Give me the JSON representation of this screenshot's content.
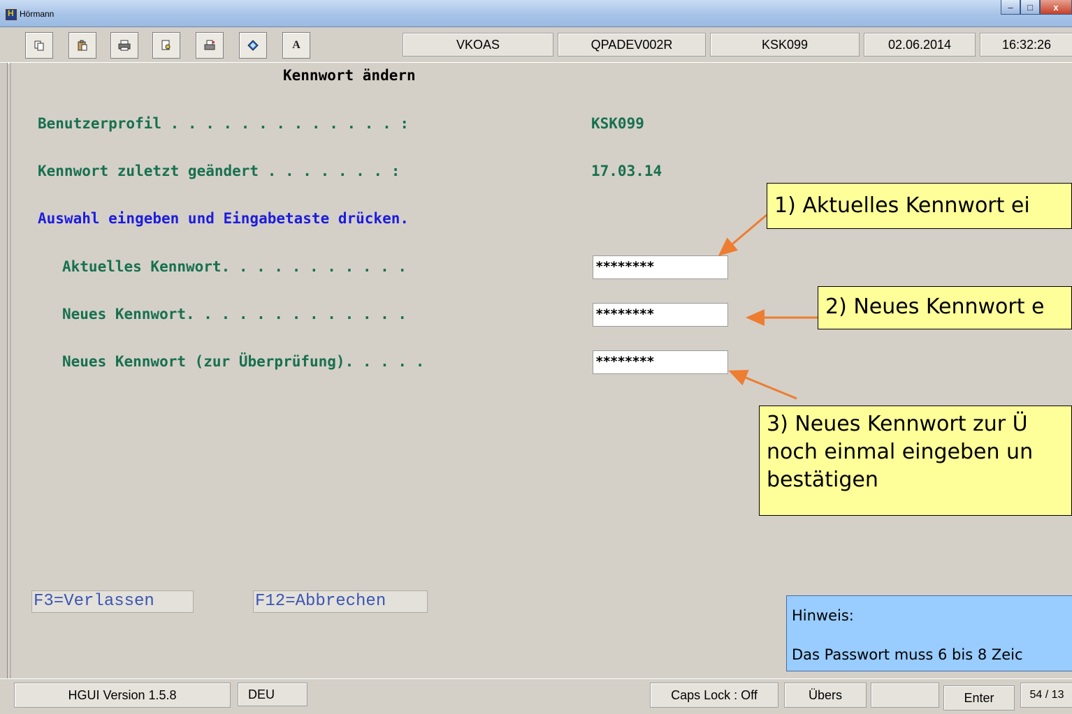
{
  "window": {
    "title": "Hörmann",
    "min": "–",
    "max": "□",
    "close": "x"
  },
  "toolbar": {
    "icons": [
      "copy-icon",
      "paste-icon",
      "print-icon",
      "print-preview-icon",
      "print-screen-icon",
      "diamond-icon",
      "font-icon"
    ],
    "font_label": "A",
    "program": "VKOAS",
    "system": "QPADEV002R",
    "user": "KSK099",
    "date": "02.06.2014",
    "time": "16:32:26"
  },
  "screen": {
    "title": "Kennwort ändern",
    "profile_label": "Benutzerprofil . . . . . . . . . . . . . :",
    "profile_value": "KSK099",
    "changed_label": "Kennwort zuletzt geändert . . . . . . . :",
    "changed_value": "17.03.14",
    "instruction": "Auswahl eingeben und Eingabetaste drücken.",
    "current_label": "Aktuelles Kennwort. . . . . . . . . . .",
    "current_value": "********",
    "new_label": "Neues Kennwort. . . . . . . . . . . . .",
    "new_value": "********",
    "verify_label": "Neues Kennwort (zur Überprüfung). . . . .",
    "verify_value": "********"
  },
  "fkeys": {
    "f3": "F3=Verlassen",
    "f12": "F12=Abbrechen"
  },
  "callouts": {
    "c1": "1) Aktuelles Kennwort ei",
    "c2": "2) Neues Kennwort e",
    "c3_line1": "3) Neues Kennwort zur Ü",
    "c3_line2": "noch einmal eingeben un",
    "c3_line3": "bestätigen"
  },
  "hint": {
    "title": "Hinweis:",
    "text": "Das Passwort muss 6 bis 8 Zeic"
  },
  "statusbar": {
    "version": "HGUI Version 1.5.8",
    "lang": "DEU",
    "caps": "Caps Lock : Off",
    "mode": "Übers",
    "empty": "",
    "enter": "Enter",
    "cursor": "54 / 13"
  },
  "colors": {
    "callout": "#ffff99",
    "hint": "#99ccff",
    "arrow": "#ed7d31",
    "field_text": "#17704f",
    "instruction_text": "#1c1ce0"
  }
}
